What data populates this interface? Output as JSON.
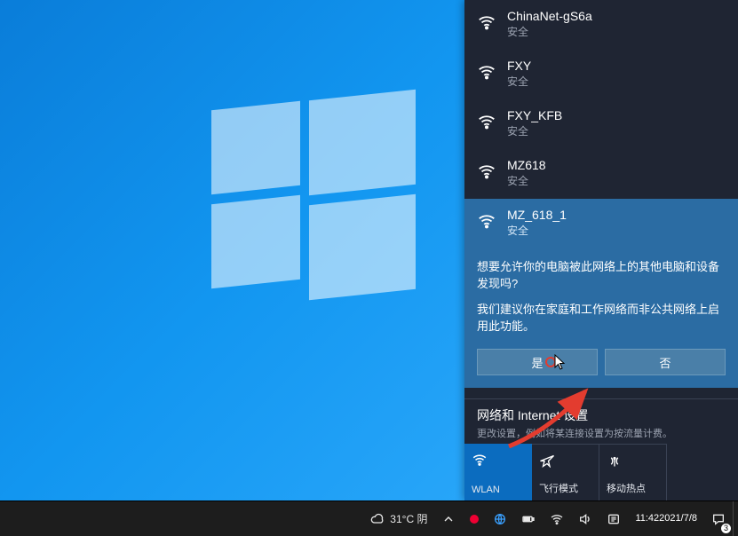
{
  "networks": [
    {
      "name": "ChinaNet-gS6a",
      "status": "安全"
    },
    {
      "name": "FXY",
      "status": "安全"
    },
    {
      "name": "FXY_KFB",
      "status": "安全"
    },
    {
      "name": "MZ618",
      "status": "安全"
    },
    {
      "name": "MZ_618_1",
      "status": "安全"
    }
  ],
  "prompt": {
    "line1": "想要允许你的电脑被此网络上的其他电脑和设备发现吗?",
    "line2": "我们建议你在家庭和工作网络而非公共网络上启用此功能。",
    "yes": "是",
    "no": "否"
  },
  "settings": {
    "title": "网络和 Internet 设置",
    "sub": "更改设置，例如将某连接设置为按流量计费。"
  },
  "tiles": {
    "wlan": "WLAN",
    "airplane": "飞行模式",
    "hotspot": "移动热点"
  },
  "taskbar": {
    "weather": "31°C 阴",
    "time": "11:42",
    "date": "2021/7/8",
    "notif_badge": "3"
  }
}
